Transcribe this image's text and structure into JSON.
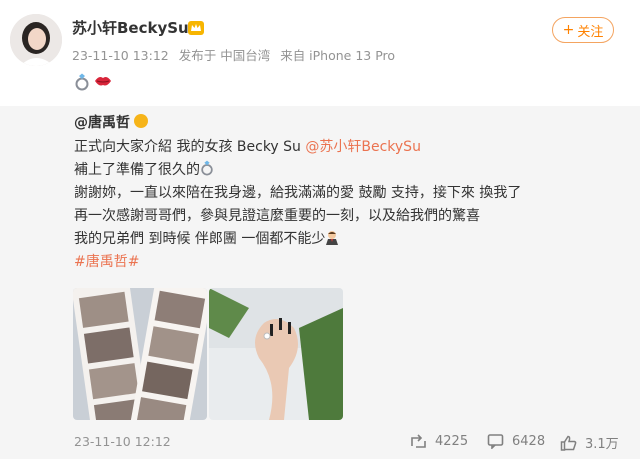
{
  "header": {
    "username": "苏小轩BeckySu",
    "time": "23-11-10 13:12",
    "posted_from": "发布于 中国台湾",
    "device": "来自 iPhone 13 Pro",
    "follow_label": "关注",
    "follow_plus": "+"
  },
  "repost": {
    "author": "@唐禹哲",
    "lines": [
      "正式向大家介紹 我的女孩 Becky Su ",
      "補上了準備了很久的",
      "謝謝妳，一直以來陪在我身邊，給我滿滿的愛 鼓勵 支持，接下來 換我了",
      "再一次感謝哥哥們，參與見證這麼重要的一刻，以及給我們的驚喜",
      "我的兄弟們 到時候 伴郎團 一個都不能少"
    ],
    "mention": "@苏小轩BeckySu",
    "hashtag": "#唐禹哲#",
    "time": "23-11-10 12:12",
    "stats": {
      "reposts": "4225",
      "comments": "6428",
      "likes": "3.1万"
    }
  },
  "icons": {
    "vip": "crown-vip-icon",
    "ring": "ring-emoji-icon",
    "lips": "lips-emoji-icon",
    "badge": "verified-badge-icon",
    "groom": "groom-emoji-icon",
    "repost": "repost-icon",
    "comment": "comment-icon",
    "like": "like-icon"
  },
  "colors": {
    "accent": "#ff8200",
    "link": "#eb7350",
    "meta": "#939393",
    "panel": "#f5f5f5"
  }
}
